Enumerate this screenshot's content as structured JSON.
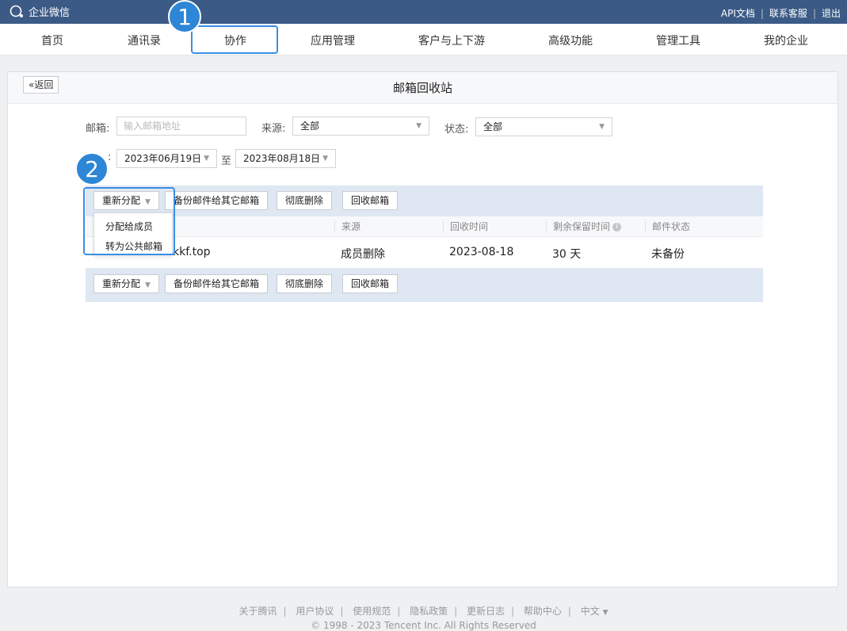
{
  "app": {
    "logo_text": "企业微信"
  },
  "toplinks": {
    "api": "API文档",
    "support": "联系客服",
    "logout": "退出"
  },
  "nav": [
    "首页",
    "通讯录",
    "协作",
    "应用管理",
    "客户与上下游",
    "高级功能",
    "管理工具",
    "我的企业"
  ],
  "markers": {
    "m1": "1",
    "m2": "2"
  },
  "page": {
    "back": "«返回",
    "title": "邮箱回收站"
  },
  "filters": {
    "email_label": "邮箱:",
    "email_placeholder": "输入邮箱地址",
    "source_label": "来源:",
    "source_value": "全部",
    "status_label": "状态:",
    "status_value": "全部",
    "date_label_visible": ":",
    "date_from": "2023年06月19日",
    "date_to_label": "至",
    "date_to": "2023年08月18日"
  },
  "toolbar": {
    "reassign": "重新分配",
    "backup": "备份邮件给其它邮箱",
    "delete": "彻底删除",
    "recycle": "回收邮箱"
  },
  "dropdown": {
    "to_member": "分配给成员",
    "to_public": "转为公共邮箱"
  },
  "table": {
    "headers": {
      "source": "来源",
      "recycle_time": "回收时间",
      "retention": "剩余保留时间",
      "status": "邮件状态"
    },
    "rows": [
      {
        "email_visible": "kkf.top",
        "source": "成员删除",
        "recycle_time": "2023-08-18",
        "retention": "30 天",
        "status": "未备份"
      }
    ]
  },
  "footer": {
    "links": [
      "关于腾讯",
      "用户协议",
      "使用规范",
      "隐私政策",
      "更新日志",
      "帮助中心",
      "中文"
    ],
    "copyright": "© 1998 - 2023 Tencent Inc. All Rights Reserved"
  },
  "colors": {
    "topbar": "#3b5a86",
    "accent": "#2d86d6",
    "toolbar_bg": "#dee7f2"
  }
}
